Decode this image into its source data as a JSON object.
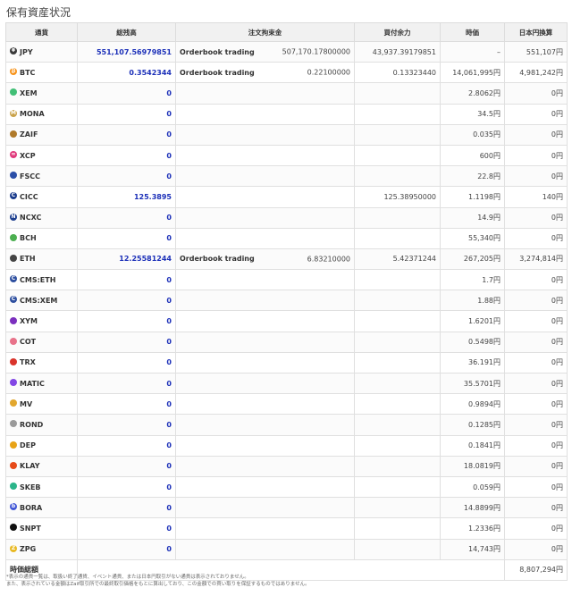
{
  "page_title": "保有資産状況",
  "columns": [
    "通貨",
    "総残高",
    "注文拘束金",
    "買付余力",
    "時価",
    "日本円換算"
  ],
  "rows": [
    {
      "currency": "JPY",
      "icon": "yen-icon",
      "color": "#3a3a3a",
      "glyph": "¥",
      "balance": "551,107.56979851",
      "order_type": "Orderbook trading",
      "order_amount": "507,170.17800000",
      "buying_power": "43,937.39179851",
      "price": "–",
      "jpy_value": "551,107円"
    },
    {
      "currency": "BTC",
      "icon": "bitcoin-icon",
      "color": "#f7931a",
      "glyph": "₿",
      "balance": "0.3542344",
      "order_type": "Orderbook trading",
      "order_amount": "0.22100000",
      "buying_power": "0.13323440",
      "price": "14,061,995円",
      "jpy_value": "4,981,242円"
    },
    {
      "currency": "XEM",
      "icon": "xem-icon",
      "color": "#41bf76",
      "glyph": "",
      "balance": "0",
      "order_type": "",
      "order_amount": "",
      "buying_power": "",
      "price": "2.8062円",
      "jpy_value": "0円"
    },
    {
      "currency": "MONA",
      "icon": "mona-icon",
      "color": "#c9a24a",
      "glyph": "M",
      "balance": "0",
      "order_type": "",
      "order_amount": "",
      "buying_power": "",
      "price": "34.5円",
      "jpy_value": "0円"
    },
    {
      "currency": "ZAIF",
      "icon": "zaif-icon",
      "color": "#b07a2a",
      "glyph": "",
      "balance": "0",
      "order_type": "",
      "order_amount": "",
      "buying_power": "",
      "price": "0.035円",
      "jpy_value": "0円"
    },
    {
      "currency": "XCP",
      "icon": "xcp-icon",
      "color": "#e03a7c",
      "glyph": "∞",
      "balance": "0",
      "order_type": "",
      "order_amount": "",
      "buying_power": "",
      "price": "600円",
      "jpy_value": "0円"
    },
    {
      "currency": "FSCC",
      "icon": "fscc-icon",
      "color": "#2b4fa8",
      "glyph": "",
      "balance": "0",
      "order_type": "",
      "order_amount": "",
      "buying_power": "",
      "price": "22.8円",
      "jpy_value": "0円"
    },
    {
      "currency": "CICC",
      "icon": "cicc-icon",
      "color": "#1b3c8c",
      "glyph": "C",
      "balance": "125.3895",
      "order_type": "",
      "order_amount": "",
      "buying_power": "125.38950000",
      "price": "1.1198円",
      "jpy_value": "140円"
    },
    {
      "currency": "NCXC",
      "icon": "ncxc-icon",
      "color": "#1d3f8f",
      "glyph": "N",
      "balance": "0",
      "order_type": "",
      "order_amount": "",
      "buying_power": "",
      "price": "14.9円",
      "jpy_value": "0円"
    },
    {
      "currency": "BCH",
      "icon": "bch-icon",
      "color": "#4caf50",
      "glyph": "",
      "balance": "0",
      "order_type": "",
      "order_amount": "",
      "buying_power": "",
      "price": "55,340円",
      "jpy_value": "0円"
    },
    {
      "currency": "ETH",
      "icon": "ethereum-icon",
      "color": "#444444",
      "glyph": "",
      "balance": "12.25581244",
      "order_type": "Orderbook trading",
      "order_amount": "6.83210000",
      "buying_power": "5.42371244",
      "price": "267,205円",
      "jpy_value": "3,274,814円"
    },
    {
      "currency": "CMS:ETH",
      "icon": "cms-eth-icon",
      "color": "#2e4f9f",
      "glyph": "C",
      "balance": "0",
      "order_type": "",
      "order_amount": "",
      "buying_power": "",
      "price": "1.7円",
      "jpy_value": "0円"
    },
    {
      "currency": "CMS:XEM",
      "icon": "cms-xem-icon",
      "color": "#2e4f9f",
      "glyph": "C",
      "balance": "0",
      "order_type": "",
      "order_amount": "",
      "buying_power": "",
      "price": "1.88円",
      "jpy_value": "0円"
    },
    {
      "currency": "XYM",
      "icon": "xym-icon",
      "color": "#7b2fbe",
      "glyph": "",
      "balance": "0",
      "order_type": "",
      "order_amount": "",
      "buying_power": "",
      "price": "1.6201円",
      "jpy_value": "0円"
    },
    {
      "currency": "COT",
      "icon": "cot-icon",
      "color": "#e8738a",
      "glyph": "",
      "balance": "0",
      "order_type": "",
      "order_amount": "",
      "buying_power": "",
      "price": "0.5498円",
      "jpy_value": "0円"
    },
    {
      "currency": "TRX",
      "icon": "tron-icon",
      "color": "#d9342b",
      "glyph": "",
      "balance": "0",
      "order_type": "",
      "order_amount": "",
      "buying_power": "",
      "price": "36.191円",
      "jpy_value": "0円"
    },
    {
      "currency": "MATIC",
      "icon": "matic-icon",
      "color": "#8247e5",
      "glyph": "",
      "balance": "0",
      "order_type": "",
      "order_amount": "",
      "buying_power": "",
      "price": "35.5701円",
      "jpy_value": "0円"
    },
    {
      "currency": "MV",
      "icon": "mv-icon",
      "color": "#e2a72e",
      "glyph": "",
      "balance": "0",
      "order_type": "",
      "order_amount": "",
      "buying_power": "",
      "price": "0.9894円",
      "jpy_value": "0円"
    },
    {
      "currency": "ROND",
      "icon": "rond-icon",
      "color": "#9a9a9a",
      "glyph": "",
      "balance": "0",
      "order_type": "",
      "order_amount": "",
      "buying_power": "",
      "price": "0.1285円",
      "jpy_value": "0円"
    },
    {
      "currency": "DEP",
      "icon": "dep-icon",
      "color": "#e8a317",
      "glyph": "",
      "balance": "0",
      "order_type": "",
      "order_amount": "",
      "buying_power": "",
      "price": "0.1841円",
      "jpy_value": "0円"
    },
    {
      "currency": "KLAY",
      "icon": "klay-icon",
      "color": "#e64a19",
      "glyph": "",
      "balance": "0",
      "order_type": "",
      "order_amount": "",
      "buying_power": "",
      "price": "18.0819円",
      "jpy_value": "0円"
    },
    {
      "currency": "SKEB",
      "icon": "skeb-icon",
      "color": "#2bb58a",
      "glyph": "",
      "balance": "0",
      "order_type": "",
      "order_amount": "",
      "buying_power": "",
      "price": "0.059円",
      "jpy_value": "0円"
    },
    {
      "currency": "BORA",
      "icon": "bora-icon",
      "color": "#4257d6",
      "glyph": "b",
      "balance": "0",
      "order_type": "",
      "order_amount": "",
      "buying_power": "",
      "price": "14.8899円",
      "jpy_value": "0円"
    },
    {
      "currency": "SNPT",
      "icon": "snpt-icon",
      "color": "#111111",
      "glyph": "",
      "balance": "0",
      "order_type": "",
      "order_amount": "",
      "buying_power": "",
      "price": "1.2336円",
      "jpy_value": "0円"
    },
    {
      "currency": "ZPG",
      "icon": "zpg-icon",
      "color": "#e8b923",
      "glyph": "Z",
      "balance": "0",
      "order_type": "",
      "order_amount": "",
      "buying_power": "",
      "price": "14,743円",
      "jpy_value": "0円"
    }
  ],
  "total": {
    "label": "時価総額",
    "value": "8,807,294円"
  },
  "notes": [
    "*表示の通貨一覧は、取扱い終了通貨、イベント通貨、または日本円取引がない通貨は表示されておりません。",
    "また、表示されている金額はZaif取引所での最終取引価格をもとに算出しており、この金額での買い取りを保証するものではありません。"
  ]
}
